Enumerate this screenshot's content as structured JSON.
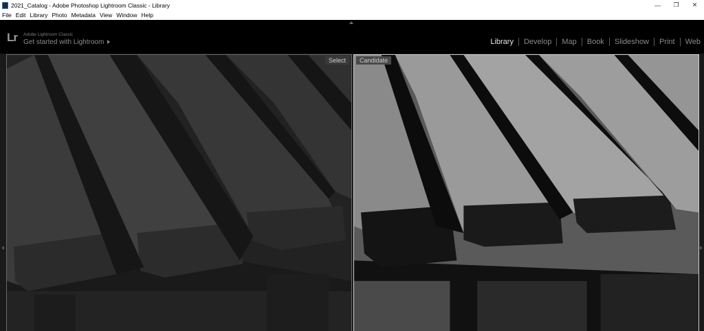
{
  "window": {
    "title": "2021_Catalog - Adobe Photoshop Lightroom Classic - Library",
    "minimize_glyph": "—",
    "restore_glyph": "❐",
    "close_glyph": "✕"
  },
  "menu": [
    "File",
    "Edit",
    "Library",
    "Photo",
    "Metadata",
    "View",
    "Window",
    "Help"
  ],
  "identity": {
    "logo": "Lr",
    "product": "Adobe Lightroom Classic",
    "tagline": "Get started with Lightroom"
  },
  "modules": {
    "items": [
      "Library",
      "Develop",
      "Map",
      "Book",
      "Slideshow",
      "Print",
      "Web"
    ],
    "active": "Library"
  },
  "compare": {
    "select_label": "Select",
    "candidate_label": "Candidate"
  },
  "colors": {
    "background": "#000000",
    "active_module": "#e8e8e8",
    "inactive_module": "#8a8a8a"
  }
}
